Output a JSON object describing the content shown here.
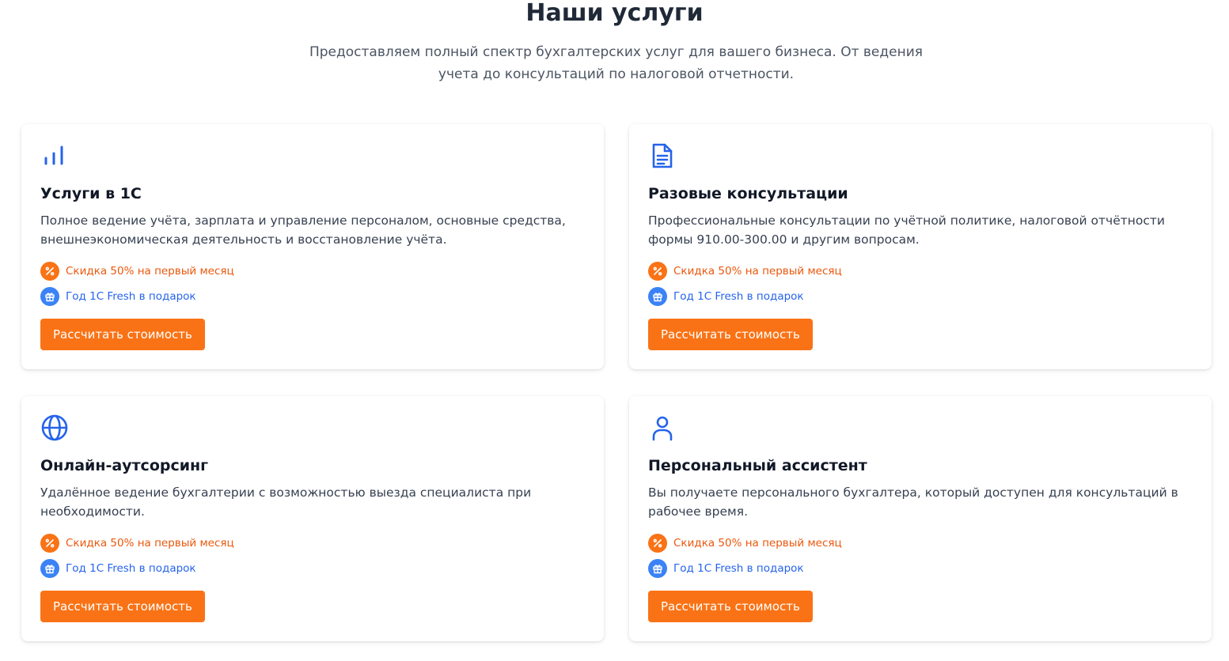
{
  "section": {
    "title": "Наши услуги",
    "subtitle": "Предоставляем полный спектр бухгалтерских услуг для вашего бизнеса. От ведения учета до консультаций по налоговой отчетности."
  },
  "colors": {
    "accent": "#f97316",
    "icon_blue": "#2563eb",
    "discount_text": "#ea580c"
  },
  "cards": [
    {
      "icon": "bar-chart-icon",
      "title": "Услуги в 1С",
      "description": "Полное ведение учёта, зарплата и управление персоналом, основные средства, внешнеэкономическая деятельность и восстановление учёта.",
      "perk_discount": "Скидка 50% на первый месяц",
      "perk_gift": "Год 1С Fresh в подарок",
      "button": "Рассчитать стоимость"
    },
    {
      "icon": "document-icon",
      "title": "Разовые консультации",
      "description": "Профессиональные консультации по учётной политике, налоговой отчётности формы 910.00-300.00 и другим вопросам.",
      "perk_discount": "Скидка 50% на первый месяц",
      "perk_gift": "Год 1С Fresh в подарок",
      "button": "Рассчитать стоимость"
    },
    {
      "icon": "globe-icon",
      "title": "Онлайн-аутсорсинг",
      "description": "Удалённое ведение бухгалтерии с возможностью выезда специалиста при необходимости.",
      "perk_discount": "Скидка 50% на первый месяц",
      "perk_gift": "Год 1С Fresh в подарок",
      "button": "Рассчитать стоимость"
    },
    {
      "icon": "user-icon",
      "title": "Персональный ассистент",
      "description": "Вы получаете персонального бухгалтера, который доступен для консультаций в рабочее время.",
      "perk_discount": "Скидка 50% на первый месяц",
      "perk_gift": "Год 1С Fresh в подарок",
      "button": "Рассчитать стоимость"
    }
  ]
}
